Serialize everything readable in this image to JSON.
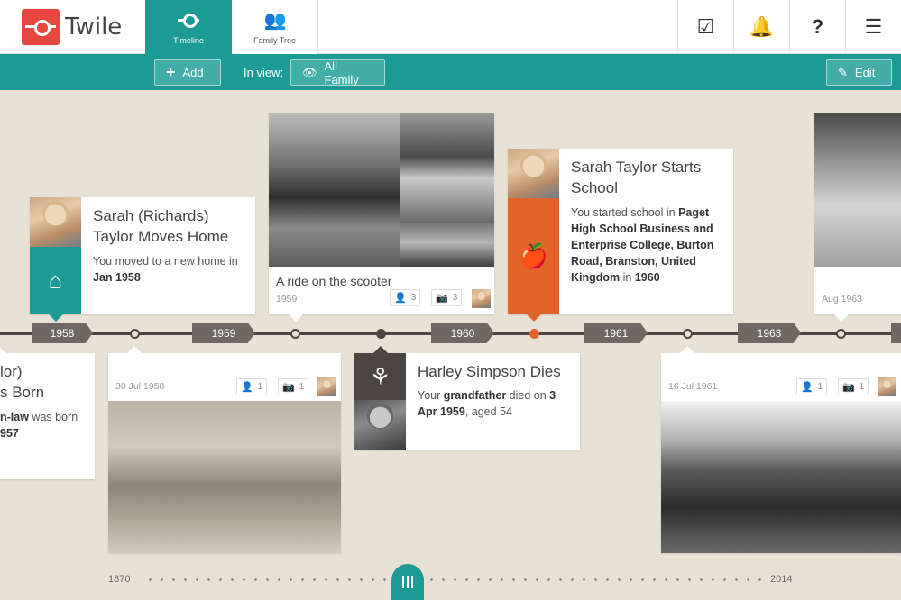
{
  "app": {
    "logo_text": "Twile"
  },
  "nav": {
    "tabs": [
      {
        "label": "Timeline",
        "icon": "timeline-icon",
        "active": true
      },
      {
        "label": "Family Tree",
        "icon": "family-tree-icon",
        "active": false
      }
    ],
    "right_icons": [
      "checkbox-icon",
      "bell-icon",
      "help-icon",
      "menu-icon"
    ],
    "right_glyphs": [
      "☑",
      "🔔",
      "?",
      "☰"
    ]
  },
  "toolbar": {
    "add_label": "Add",
    "in_view_label": "In view:",
    "view_value": "All Family",
    "edit_label": "Edit"
  },
  "timeline": {
    "years": [
      "1958",
      "1959",
      "1960",
      "1961",
      "1963"
    ]
  },
  "cards": {
    "moves_home": {
      "title": "Sarah (Richards) Taylor Moves Home",
      "text_pre": "You moved to a new home in ",
      "text_bold": "Jan 1958",
      "icon": "home-icon"
    },
    "scooter": {
      "title": "A ride on the scooter",
      "date": "1959",
      "people_count": "3",
      "photo_count": "3"
    },
    "starts_school": {
      "title": "Sarah Taylor Starts School",
      "text_pre": "You started school in ",
      "text_bold": "Paget High School Business and Enterprise College, Burton Road, Branston, United Kingdom",
      "text_mid": " in ",
      "text_bold2": "1960",
      "icon": "apple-books-icon"
    },
    "sea_photo": {
      "date": "Aug 1963"
    },
    "born": {
      "title_line1": "lor)",
      "title_line2": "s Born",
      "text_bold": "n-law",
      "text_rest": " was born",
      "text_bold2": "957"
    },
    "beach": {
      "date": "30 Jul 1958",
      "people_count": "1",
      "photo_count": "1"
    },
    "harley": {
      "title": "Harley Simpson Dies",
      "text_pre": "Your ",
      "text_bold": "grandfather",
      "text_mid": " died on ",
      "text_bold2": "3 Apr 1959",
      "text_post": ", aged 54",
      "icon": "rose-icon"
    },
    "grass": {
      "date": "16 Jul 1961",
      "people_count": "1",
      "photo_count": "1"
    }
  },
  "scrubber": {
    "start": "1870",
    "end": "2014"
  },
  "colors": {
    "teal": "#1c9b96",
    "orange": "#e1652b",
    "dark": "#4a4540",
    "background": "#e8e2d6"
  }
}
